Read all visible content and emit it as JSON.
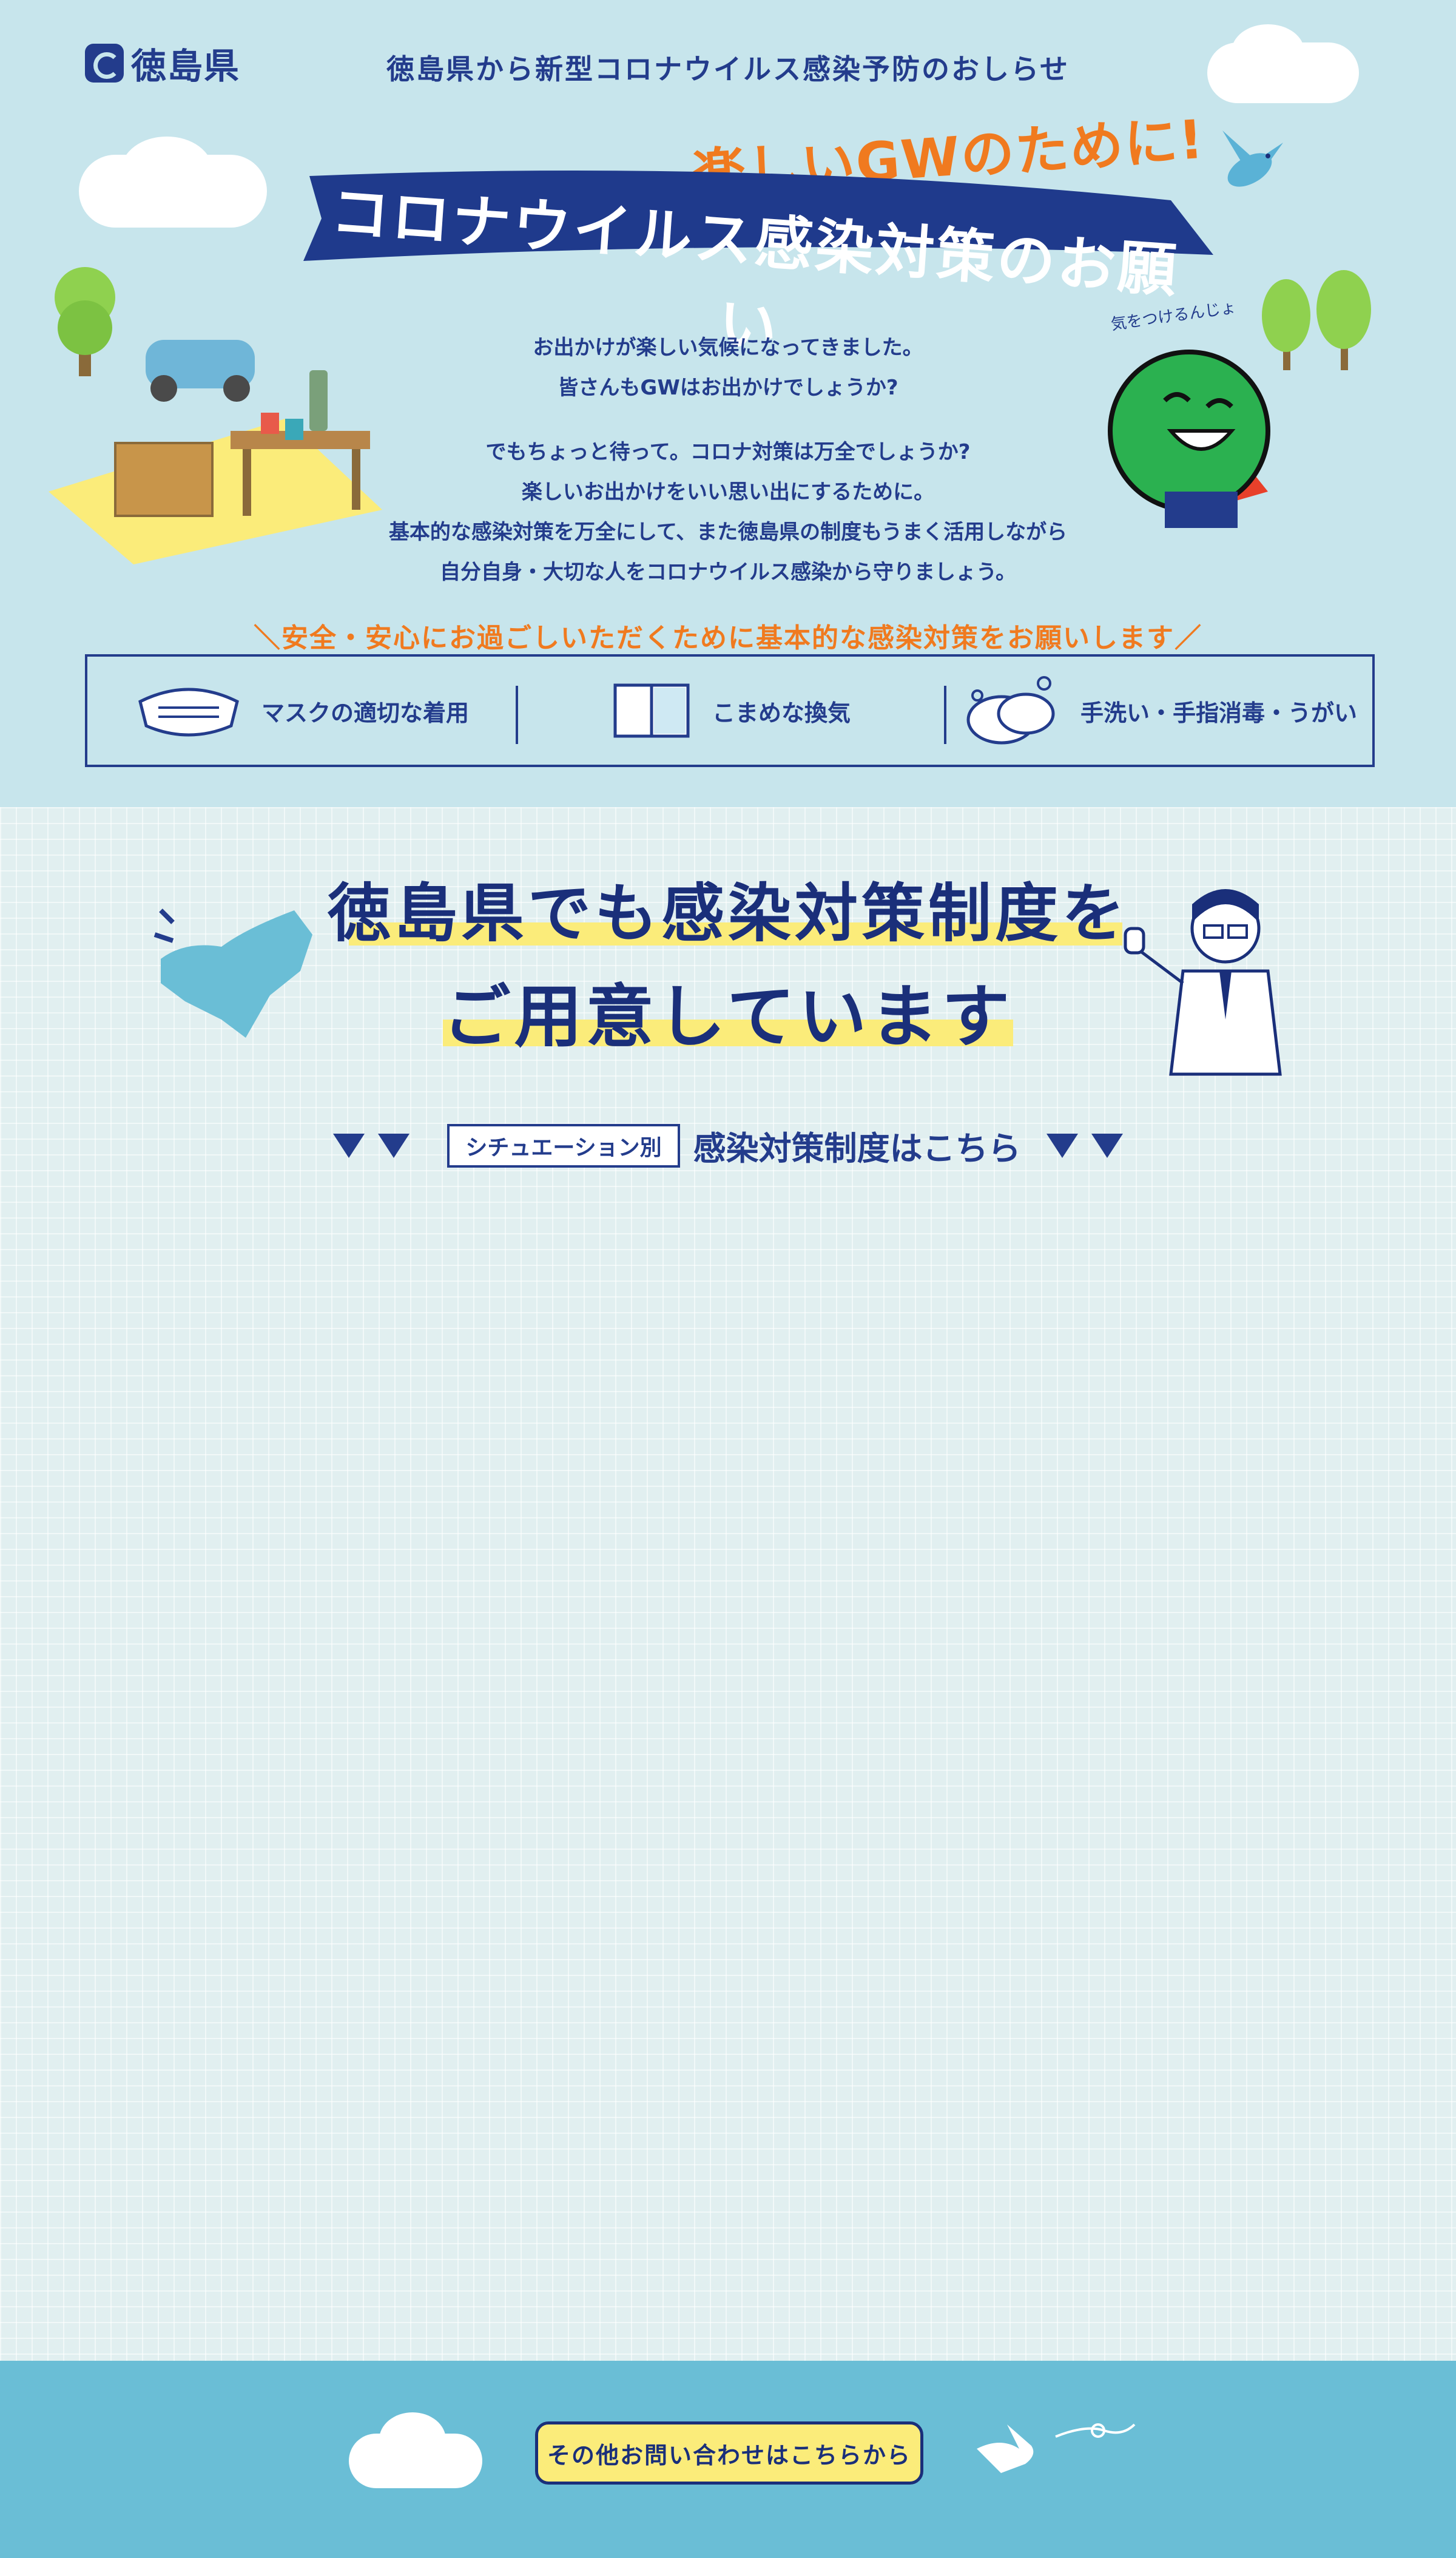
{
  "header": {
    "logo_text": "徳島県",
    "title": "徳島県から新型コロナウイルス感染予防のおしらせ"
  },
  "hero": {
    "subtitle": "楽しいGWのために!",
    "banner": "コロナウイルス感染対策のお願い",
    "character_caption": "気をつけるんじょ",
    "intro_lines_1": [
      "お出かけが楽しい気候になってきました。",
      "皆さんもGWはお出かけでしょうか?"
    ],
    "intro_lines_2": [
      "でもちょっと待って。コロナ対策は万全でしょうか?",
      "楽しいお出かけをいい思い出にするために。",
      "基本的な感染対策を万全にして、また徳島県の制度もうまく活用しながら",
      "自分自身・大切な人をコロナウイルス感染から守りましょう。"
    ]
  },
  "safety": {
    "title": "＼安全・安心にお過ごしいただくために基本的な感染対策をお願いします／",
    "measures": [
      {
        "icon": "mask-icon",
        "label": "マスクの適切な着用"
      },
      {
        "icon": "window-icon",
        "label": "こまめな換気"
      },
      {
        "icon": "handwash-icon",
        "label": "手洗い・手指消毒・うがい"
      }
    ]
  },
  "section": {
    "title_line1": "徳島県でも感染対策制度を",
    "title_line2": "ご用意しています",
    "situation_tag": "シチュエーション別",
    "situation_text": "感染対策制度はこちら"
  },
  "footer": {
    "contact_button": "その他お問い合わせはこちらから"
  },
  "colors": {
    "navy": "#1a2f7a",
    "orange": "#f07a1f",
    "hero_bg": "#c7e5ec",
    "footer_bg": "#6abed6",
    "highlight": "#fbec7a"
  }
}
